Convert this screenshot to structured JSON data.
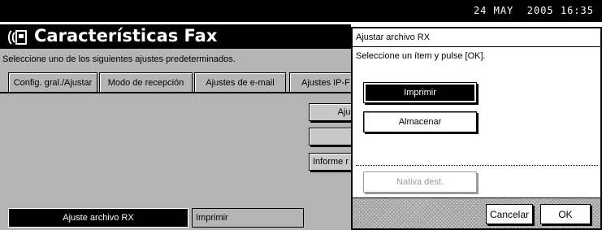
{
  "header": {
    "date": "24 MAY",
    "time": "2005 16:35"
  },
  "screen": {
    "title": "Características Fax",
    "instruction": "Seleccione uno de los siguientes ajustes predeterminados.",
    "tabs": [
      {
        "label": "Config. gral./Ajustar"
      },
      {
        "label": "Modo de recepción"
      },
      {
        "label": "Ajustes de e-mail"
      },
      {
        "label": "Ajustes IP-F"
      }
    ],
    "buttons": [
      {
        "label": "Ajus"
      },
      {
        "label": ""
      },
      {
        "label": "Informe r"
      }
    ],
    "rx_setting": {
      "label": "Ajuste archivo RX",
      "value": "Imprimir"
    }
  },
  "dialog": {
    "title": "Ajustar archivo RX",
    "instruction": "Seleccione un ítem y pulse [OK].",
    "options": [
      {
        "label": "Imprimir",
        "state": "selected"
      },
      {
        "label": "Almacenar",
        "state": "normal"
      },
      {
        "label": "Nativa dest.",
        "state": "disabled"
      }
    ],
    "cancel_label": "Cancelar",
    "ok_label": "OK"
  }
}
